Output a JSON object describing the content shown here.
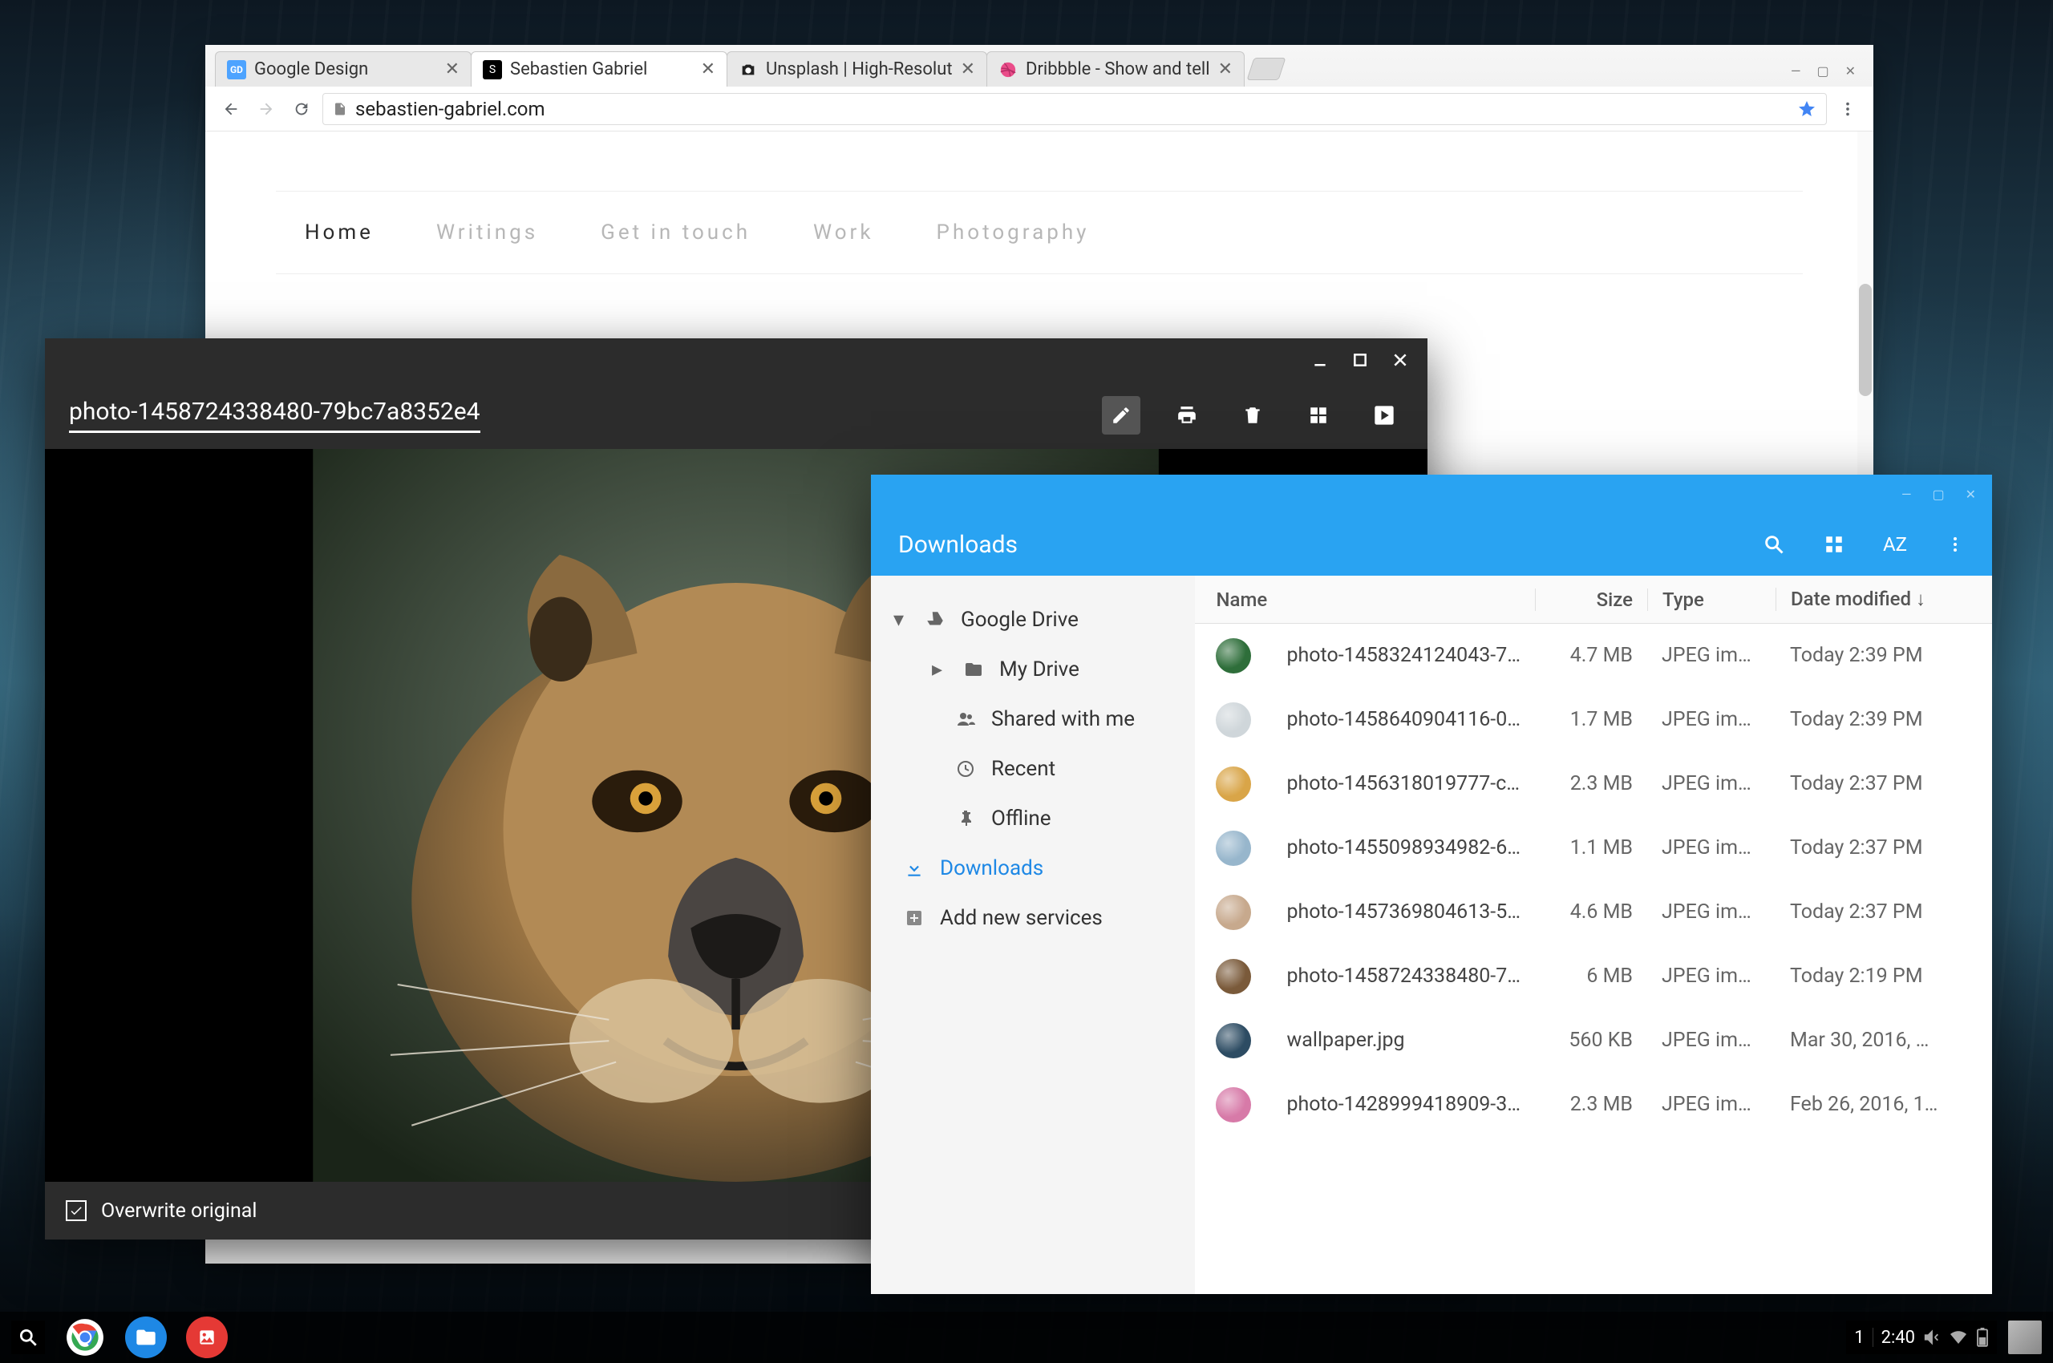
{
  "browser": {
    "tabs": [
      {
        "label": "Google Design",
        "favicon_bg": "#4da3ff",
        "favicon_text": "GD"
      },
      {
        "label": "Sebastien Gabriel",
        "favicon_bg": "#ffffff",
        "favicon_text": "S"
      },
      {
        "label": "Unsplash | High-Resolut",
        "favicon_bg": "#000000",
        "favicon_text": "●"
      },
      {
        "label": "Dribbble - Show and tell",
        "favicon_bg": "#ea4c89",
        "favicon_text": "◉"
      }
    ],
    "active_tab_index": 1,
    "url": "sebastien-gabriel.com",
    "nav": [
      {
        "label": "Home",
        "active": true
      },
      {
        "label": "Writings",
        "active": false
      },
      {
        "label": "Get in touch",
        "active": false
      },
      {
        "label": "Work",
        "active": false
      },
      {
        "label": "Photography",
        "active": false
      }
    ]
  },
  "viewer": {
    "filename": "photo-1458724338480-79bc7a8352e4",
    "footer_label": "Overwrite original"
  },
  "files": {
    "title": "Downloads",
    "sort_label": "AZ",
    "sidebar": {
      "root": "Google Drive",
      "my_drive": "My Drive",
      "shared": "Shared with me",
      "recent": "Recent",
      "offline": "Offline",
      "downloads": "Downloads",
      "add": "Add new services"
    },
    "columns": {
      "name": "Name",
      "size": "Size",
      "type": "Type",
      "date": "Date modified ↓"
    },
    "rows": [
      {
        "name": "photo-1458324124043-7…",
        "size": "4.7 MB",
        "type": "JPEG im…",
        "date": "Today 2:39 PM",
        "color": "#2e6e3a"
      },
      {
        "name": "photo-1458640904116-0…",
        "size": "1.7 MB",
        "type": "JPEG im…",
        "date": "Today 2:39 PM",
        "color": "#cfd6da"
      },
      {
        "name": "photo-1456318019777-c…",
        "size": "2.3 MB",
        "type": "JPEG im…",
        "date": "Today 2:37 PM",
        "color": "#d9a548"
      },
      {
        "name": "photo-1455098934982-6…",
        "size": "1.1 MB",
        "type": "JPEG im…",
        "date": "Today 2:37 PM",
        "color": "#97b6cc"
      },
      {
        "name": "photo-1457369804613-5…",
        "size": "4.6 MB",
        "type": "JPEG im…",
        "date": "Today 2:37 PM",
        "color": "#c7a98d"
      },
      {
        "name": "photo-1458724338480-7…",
        "size": "6 MB",
        "type": "JPEG im…",
        "date": "Today 2:19 PM",
        "color": "#7a5a3a"
      },
      {
        "name": "wallpaper.jpg",
        "size": "560 KB",
        "type": "JPEG im…",
        "date": "Mar 30, 2016, …",
        "color": "#2d4c63"
      },
      {
        "name": "photo-1428999418909-3…",
        "size": "2.3 MB",
        "type": "JPEG im…",
        "date": "Feb 26, 2016, 1…",
        "color": "#d77aa8"
      }
    ]
  },
  "tray": {
    "notif_count": "1",
    "clock": "2:40"
  }
}
